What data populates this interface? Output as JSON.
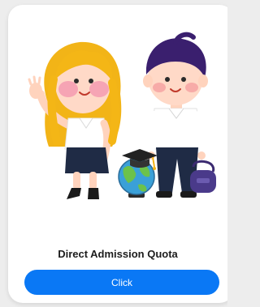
{
  "card": {
    "title": "Direct Admission Quota",
    "button_label": "Click"
  },
  "illustration": {
    "icons": [
      "girl-student-icon",
      "boy-student-icon",
      "globe-icon",
      "graduation-cap-icon",
      "school-bag-icon"
    ]
  },
  "colors": {
    "button_bg": "#0a78f5",
    "card_bg": "#ffffff",
    "page_bg": "#ededed"
  }
}
